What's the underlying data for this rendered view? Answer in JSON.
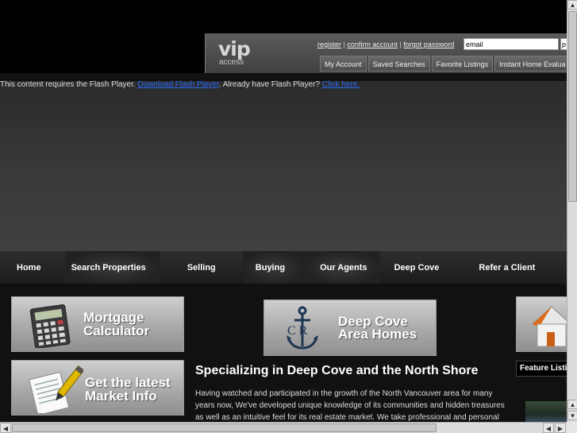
{
  "vip": {
    "logo_big": "vip",
    "logo_small": "access",
    "links": [
      "register",
      "confirm account",
      "forgot password"
    ],
    "separator": "|",
    "email_value": "email",
    "password_value": "p",
    "tabs": [
      "My Account",
      "Saved Searches",
      "Favorite Listings",
      "Instant Home Evalua"
    ]
  },
  "flash": {
    "message_pre": "This content requires the Flash Player. ",
    "download_link": "Download Flash Player",
    "message_mid": ". Already have Flash Player? ",
    "click_link": "Click here."
  },
  "nav": [
    "Home",
    "Search Properties",
    "Selling",
    "Buying",
    "Our Agents",
    "Deep Cove",
    "Refer a Client"
  ],
  "promos": {
    "mortgage": {
      "line1": "Mortgage",
      "line2": "Calculator",
      "icon": "calculator-icon"
    },
    "market": {
      "line1": "Get the latest",
      "line2": "Market Info",
      "icon": "document-pen-icon"
    },
    "deepcove": {
      "line1": "Deep Cove",
      "line2": "Area Homes",
      "icon": "anchor-logo-icon",
      "logo_letters": "C R"
    },
    "house": {
      "icon": "house-icon"
    }
  },
  "main": {
    "heading": "Specializing in Deep Cove and the North Shore",
    "paragraph": "Having watched and participated in the growth of the North Vancouver area for many years now, We've developed unique knowledge of its communities and hidden treasures as well as an intuitive feel for its real estate market. We take professional and personal"
  },
  "feature": {
    "tab_label": "Feature Listi"
  },
  "colors": {
    "link": "#2a6bff",
    "background": "#000000",
    "nav_text": "#ffffff"
  }
}
